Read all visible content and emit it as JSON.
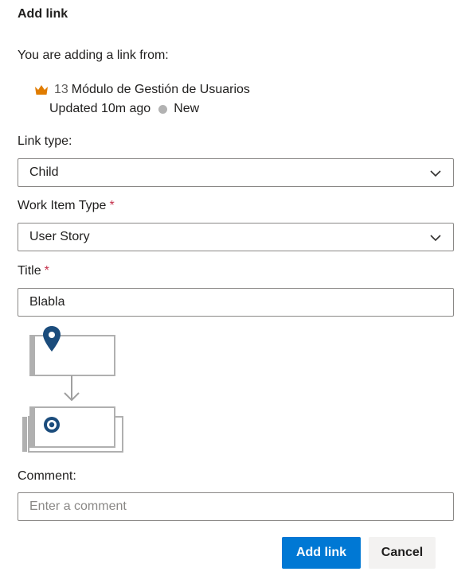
{
  "dialog": {
    "title": "Add link",
    "intro": "You are adding a link from:"
  },
  "source_item": {
    "icon": "crown-icon",
    "icon_color": "#e07c00",
    "id": "13",
    "title": "Módulo de Gestión de Usuarios",
    "updated": "Updated 10m ago",
    "state": "New",
    "state_color": "#b2b2b2"
  },
  "link_type": {
    "label": "Link type:",
    "value": "Child"
  },
  "work_item_type": {
    "label": "Work Item Type",
    "required_mark": "*",
    "value": "User Story"
  },
  "title_field": {
    "label": "Title",
    "required_mark": "*",
    "value": "Blabla"
  },
  "comment": {
    "label": "Comment:",
    "placeholder": "Enter a comment",
    "value": ""
  },
  "buttons": {
    "add_link": "Add link",
    "cancel": "Cancel"
  },
  "colors": {
    "primary": "#0078d4",
    "required": "#c4314b",
    "diagram_pin": "#1b4c7c"
  }
}
